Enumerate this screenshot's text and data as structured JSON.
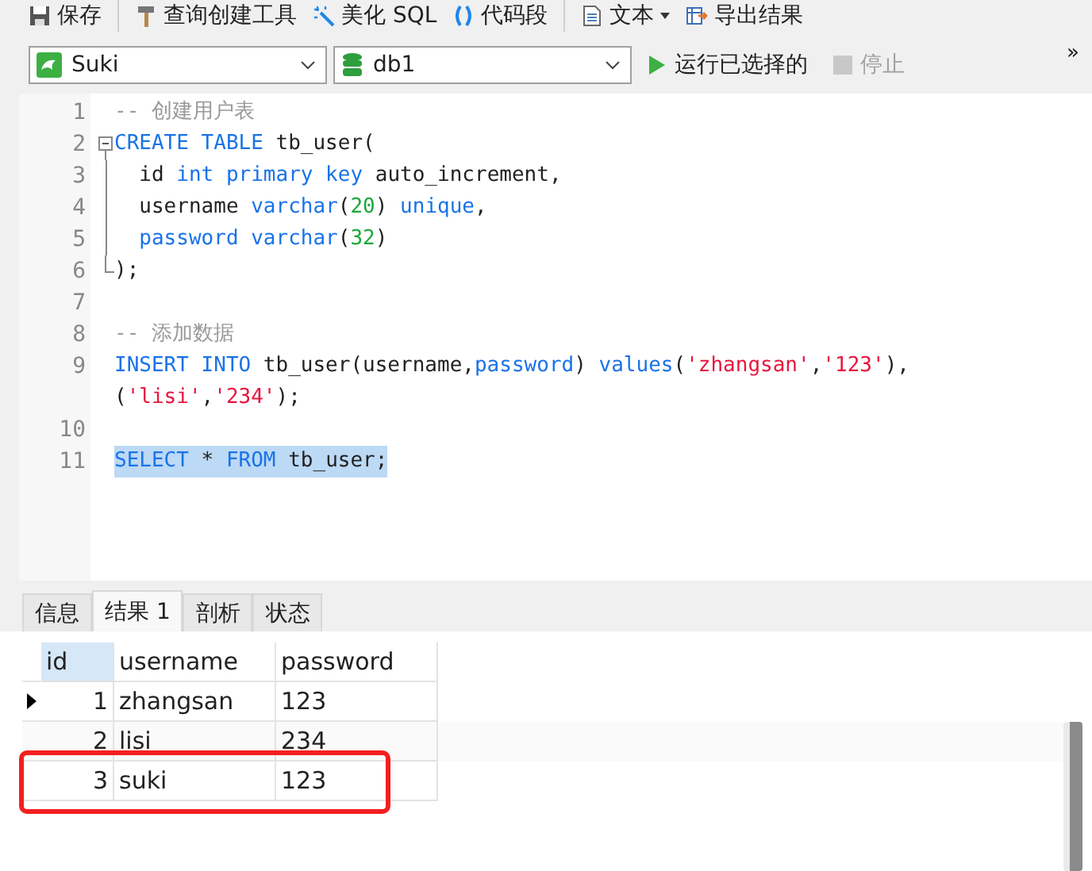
{
  "toolbar": [
    {
      "label": "保存"
    },
    {
      "label": "查询创建工具"
    },
    {
      "label": "美化 SQL"
    },
    {
      "label": "代码段"
    },
    {
      "label": "文本",
      "dropdown": true
    },
    {
      "label": "导出结果",
      "dropdown": false
    }
  ],
  "connection": {
    "value": "Suki"
  },
  "database": {
    "value": "db1"
  },
  "run": {
    "label": "运行已选择的",
    "disabled": false
  },
  "stop": {
    "label": "停止",
    "disabled": true
  },
  "overflow": "»",
  "editor_lines": [
    {
      "number": "1",
      "kind": "line",
      "highlighted": false,
      "tokens": [
        {
          "kind": "comment",
          "text": "-- 创建用户表"
        }
      ]
    },
    {
      "number": "2",
      "kind": "opener",
      "highlighted": false,
      "tokens": [
        {
          "kind": "kw",
          "text": "CREATE TABLE"
        },
        {
          "kind": "plain",
          "text": " tb_user("
        }
      ]
    },
    {
      "number": "3",
      "kind": "body",
      "highlighted": false,
      "tokens": [
        {
          "kind": "plain",
          "text": "  id "
        },
        {
          "kind": "kw",
          "text": "int primary key"
        },
        {
          "kind": "plain",
          "text": " auto_increment,"
        }
      ]
    },
    {
      "number": "4",
      "kind": "body",
      "highlighted": false,
      "tokens": [
        {
          "kind": "plain",
          "text": "  username "
        },
        {
          "kind": "kw",
          "text": "varchar"
        },
        {
          "kind": "plain",
          "text": "("
        },
        {
          "kind": "num",
          "text": "20"
        },
        {
          "kind": "plain",
          "text": ") "
        },
        {
          "kind": "kw",
          "text": "unique"
        },
        {
          "kind": "plain",
          "text": ","
        }
      ]
    },
    {
      "number": "5",
      "kind": "body",
      "highlighted": false,
      "tokens": [
        {
          "kind": "kw",
          "text": "  password varchar"
        },
        {
          "kind": "plain",
          "text": "("
        },
        {
          "kind": "num",
          "text": "32"
        },
        {
          "kind": "plain",
          "text": ")"
        }
      ]
    },
    {
      "number": "6",
      "kind": "closer",
      "highlighted": false,
      "tokens": [
        {
          "kind": "plain",
          "text": ");"
        }
      ]
    },
    {
      "number": "7",
      "kind": "line"
    },
    {
      "number": "8",
      "kind": "line",
      "highlighted": false,
      "tokens": [
        {
          "kind": "comment",
          "text": "-- 添加数据"
        }
      ]
    },
    {
      "number": "9",
      "kind": "line",
      "highlighted": false,
      "tokens": [
        {
          "kind": "kw",
          "text": "INSERT INTO"
        },
        {
          "kind": "plain",
          "text": " tb_user(username,"
        },
        {
          "kind": "kw",
          "text": "password"
        },
        {
          "kind": "plain",
          "text": ") "
        },
        {
          "kind": "kw",
          "text": "values"
        },
        {
          "kind": "plain",
          "text": "("
        },
        {
          "kind": "str",
          "text": "'zhangsan'"
        },
        {
          "kind": "plain",
          "text": ","
        },
        {
          "kind": "str",
          "text": "'123'"
        },
        {
          "kind": "plain",
          "text": "),("
        },
        {
          "kind": "str",
          "text": "'lisi'"
        },
        {
          "kind": "plain",
          "text": ","
        },
        {
          "kind": "str",
          "text": "'234'"
        },
        {
          "kind": "plain",
          "text": ");"
        }
      ]
    },
    {
      "number": "10",
      "kind": "line"
    },
    {
      "number": "11",
      "kind": "line",
      "highlighted": true,
      "tokens": [
        {
          "kind": "kw",
          "text": "SELECT"
        },
        {
          "kind": "plain",
          "text": " * "
        },
        {
          "kind": "kw",
          "text": "FROM"
        },
        {
          "kind": "plain",
          "text": " tb_user;"
        }
      ]
    }
  ],
  "result_tabs": [
    {
      "label": "信息",
      "selected": false
    },
    {
      "label": "结果 1",
      "selected": true
    },
    {
      "label": "剖析",
      "selected": false
    },
    {
      "label": "状态",
      "selected": false
    }
  ],
  "grid": {
    "columns": [
      "id",
      "username",
      "password"
    ],
    "rows": [
      {
        "cells": [
          "1",
          "zhangsan",
          "123"
        ],
        "current": true,
        "annotated": false
      },
      {
        "cells": [
          "2",
          "lisi",
          "234"
        ],
        "current": false,
        "annotated": false
      },
      {
        "cells": [
          "3",
          "suki",
          "123"
        ],
        "current": false,
        "annotated": true
      }
    ]
  }
}
